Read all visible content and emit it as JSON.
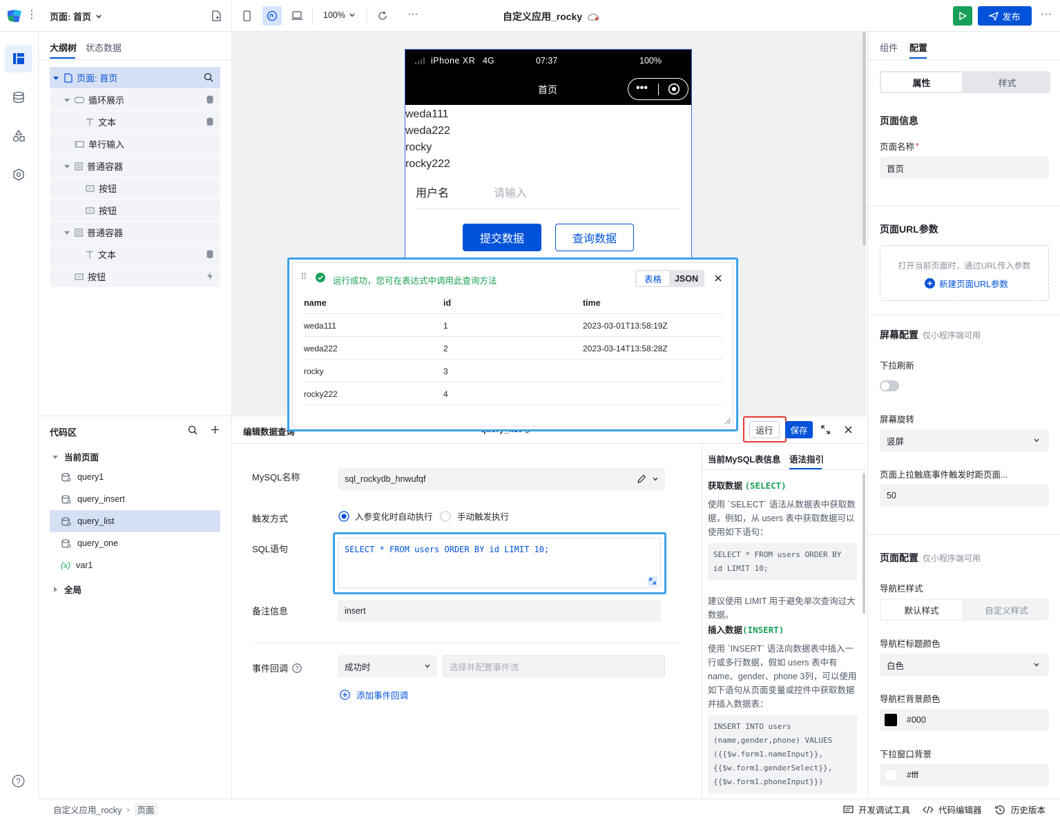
{
  "topbar": {
    "page_selector": "页面: 首页",
    "zoom": "100%",
    "app_title": "自定义应用_rocky",
    "publish": "发布"
  },
  "outline": {
    "tab_tree": "大纲树",
    "tab_state": "状态数据",
    "nodes": [
      "页面: 首页",
      "循环展示",
      "文本",
      "单行输入",
      "普通容器",
      "按钮",
      "按钮",
      "普通容器",
      "文本",
      "按钮"
    ]
  },
  "codearea": {
    "title": "代码区",
    "current_page": "当前页面",
    "items": [
      "query1",
      "query_insert",
      "query_list",
      "query_one",
      "var1"
    ],
    "global": "全局"
  },
  "phone": {
    "device": "iPhone XR",
    "network": "4G",
    "time": "07:37",
    "battery": "100%",
    "nav_title": "首页",
    "list": [
      "weda111",
      "weda222",
      "rocky",
      "rocky222"
    ],
    "username_label": "用户名",
    "username_placeholder": "请输入",
    "submit_btn": "提交数据",
    "query_btn": "查询数据"
  },
  "result_popup": {
    "message": "运行成功，您可在表达式中调用此查询方法",
    "view_table": "表格",
    "view_json": "JSON",
    "columns": [
      "name",
      "id",
      "time"
    ],
    "rows": [
      [
        "weda111",
        "1",
        "2023-03-01T13:58:19Z"
      ],
      [
        "weda222",
        "2",
        "2023-03-14T13:58:28Z"
      ],
      [
        "rocky",
        "3",
        ""
      ],
      [
        "rocky222",
        "4",
        ""
      ]
    ]
  },
  "editor": {
    "title": "编辑数据查询",
    "query_name": "query_list",
    "run": "运行",
    "save": "保存",
    "mysql_label": "MySQL名称",
    "mysql_value": "sql_rockydb_hnwufqf",
    "trigger_label": "触发方式",
    "trigger_auto": "入参变化时自动执行",
    "trigger_manual": "手动触发执行",
    "sql_label": "SQL语句",
    "sql_value": "SELECT * FROM users ORDER BY id LIMIT 10;",
    "remark_label": "备注信息",
    "remark_value": "insert",
    "event_label": "事件回调",
    "event_when": "成功时",
    "event_placeholder": "选择并配置事件流",
    "add_event": "添加事件回调"
  },
  "guide": {
    "tab_table": "当前MySQL表信息",
    "tab_syntax": "语法指引",
    "select_title": "获取数据",
    "select_kw": "(SELECT)",
    "select_desc": "使用 `SELECT` 语法从数据表中获取数据，例如，从 users 表中获取数据可以使用如下语句：",
    "select_code": "SELECT * FROM users ORDER BY id LIMIT 10;",
    "limit_tip": "建议使用 LIMIT 用于避免单次查询过大数据。",
    "insert_title": "插入数据",
    "insert_kw": "(INSERT)",
    "insert_desc": "使用 `INSERT` 语法向数据表中插入一行或多行数据，假如 users 表中有 name、gender、phone 3列，可以使用如下语句从页面变量或控件中获取数据并插入数据表：",
    "insert_code": [
      "INSERT INTO users",
      "(name,gender,phone) VALUES",
      "({{$w.form1.nameInput}},",
      "{{$w.form1.genderSelect}},",
      "{{$w.form1.phoneInput}})"
    ]
  },
  "right": {
    "tab_component": "组件",
    "tab_config": "配置",
    "seg_props": "属性",
    "seg_style": "样式",
    "page_info": "页面信息",
    "page_name_label": "页面名称",
    "page_name": "首页",
    "url_params": "页面URL参数",
    "url_hint": "打开当前页面时，通过URL传入参数",
    "url_new": "新建页面URL参数",
    "screen_config": "屏幕配置",
    "mini_only": "仅小程序端可用",
    "pull_refresh": "下拉刷新",
    "rotate": "屏幕旋转",
    "rotate_value": "竖屏",
    "reach_bottom": "页面上拉触底事件触发时距页面...",
    "reach_bottom_value": "50",
    "page_config": "页面配置",
    "nav_style": "导航栏样式",
    "nav_default": "默认样式",
    "nav_custom": "自定义样式",
    "nav_title_color": "导航栏标题颜色",
    "nav_title_color_value": "白色",
    "nav_bg_color": "导航栏背景颜色",
    "nav_bg_value": "#000",
    "pull_bg": "下拉窗口背景",
    "pull_bg_value": "#fff"
  },
  "statusbar": {
    "crumb_app": "自定义应用_rocky",
    "crumb_page": "页面",
    "devtools": "开发调试工具",
    "code_editor": "代码编辑器",
    "history": "历史版本"
  }
}
